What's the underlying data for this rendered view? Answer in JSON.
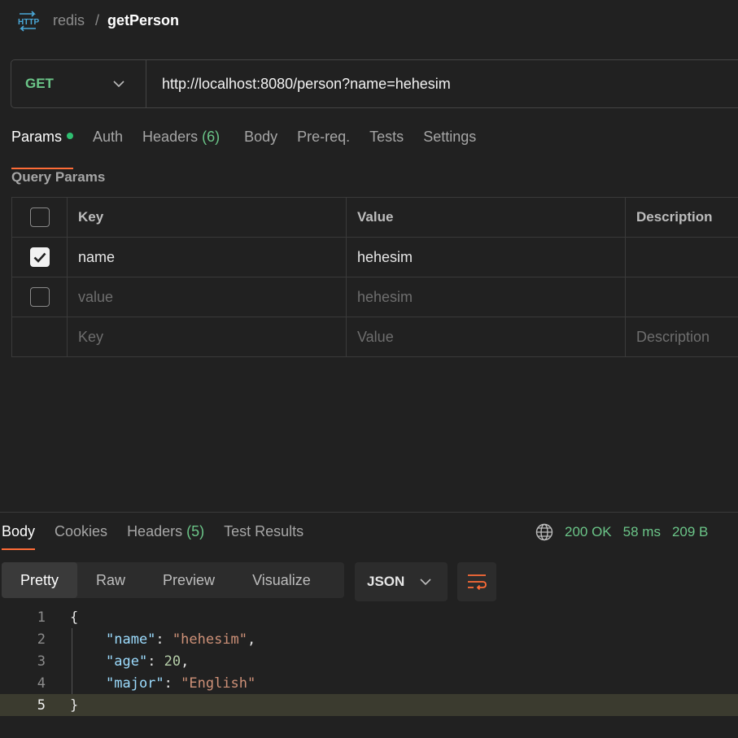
{
  "header": {
    "icon": "http-icon",
    "collection": "redis",
    "separator": "/",
    "request_name": "getPerson"
  },
  "url_bar": {
    "method": "GET",
    "url": "http://localhost:8080/person?name=hehesim"
  },
  "request_tabs": [
    {
      "label": "Params",
      "active": true,
      "indicator": "green-dot"
    },
    {
      "label": "Auth"
    },
    {
      "label": "Headers",
      "count": "(6)"
    },
    {
      "label": "Body"
    },
    {
      "label": "Pre-req."
    },
    {
      "label": "Tests"
    },
    {
      "label": "Settings"
    }
  ],
  "query_params": {
    "title": "Query Params",
    "columns": [
      "Key",
      "Value",
      "Description"
    ],
    "rows": [
      {
        "checked": true,
        "key": "name",
        "value": "hehesim",
        "description": ""
      },
      {
        "checked": false,
        "key": "value",
        "value": "hehesim",
        "description": ""
      }
    ],
    "placeholder": {
      "key": "Key",
      "value": "Value",
      "description": "Description"
    }
  },
  "response": {
    "tabs": [
      {
        "label": "Body",
        "active": true
      },
      {
        "label": "Cookies"
      },
      {
        "label": "Headers",
        "count": "(5)"
      },
      {
        "label": "Test Results"
      }
    ],
    "status": "200 OK",
    "time": "58 ms",
    "size": "209 B",
    "views": [
      "Pretty",
      "Raw",
      "Preview",
      "Visualize"
    ],
    "active_view": "Pretty",
    "format": "JSON",
    "body_lines": [
      {
        "n": "1",
        "text": "{"
      },
      {
        "n": "2",
        "key": "\"name\"",
        "sep": ": ",
        "val": "\"hehesim\"",
        "end": ","
      },
      {
        "n": "3",
        "key": "\"age\"",
        "sep": ": ",
        "val": "20",
        "end": ","
      },
      {
        "n": "4",
        "key": "\"major\"",
        "sep": ": ",
        "val": "\"English\"",
        "end": ""
      },
      {
        "n": "5",
        "text": "}"
      }
    ]
  },
  "colors": {
    "background": "#212121",
    "method_green": "#6bc588",
    "accent_orange": "#ff6c37",
    "json_key": "#9cdcfe",
    "json_string": "#ce9178",
    "json_number": "#b5cea8"
  }
}
